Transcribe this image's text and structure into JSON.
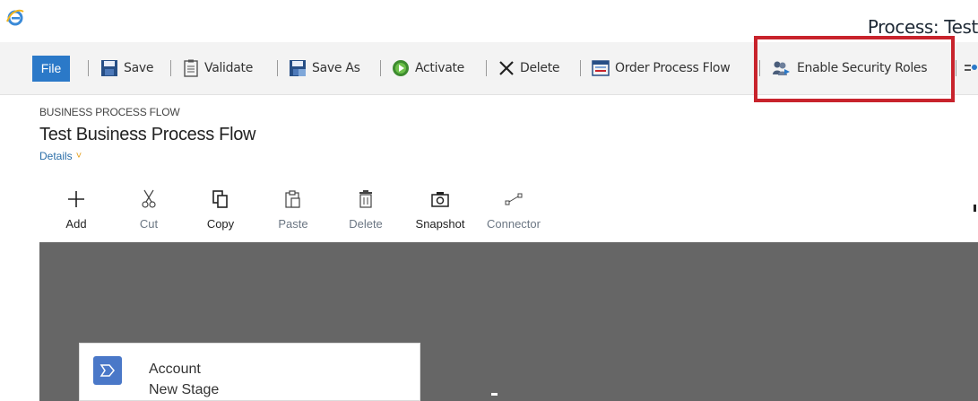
{
  "window": {
    "title": "Process: Test"
  },
  "commandbar": {
    "file": "File",
    "items": [
      {
        "label": "Save",
        "icon": "save-icon"
      },
      {
        "label": "Validate",
        "icon": "validate-icon"
      },
      {
        "label": "Save As",
        "icon": "save-as-icon"
      },
      {
        "label": "Activate",
        "icon": "activate-icon"
      },
      {
        "label": "Delete",
        "icon": "delete-x-icon"
      },
      {
        "label": "Order Process Flow",
        "icon": "order-process-flow-icon"
      },
      {
        "label": "Enable Security Roles",
        "icon": "enable-security-roles-icon"
      }
    ]
  },
  "header": {
    "entity_label": "BUSINESS PROCESS FLOW",
    "title": "Test Business Process Flow",
    "details": "Details"
  },
  "designer_toolbar": [
    {
      "label": "Add",
      "icon": "plus-icon",
      "enabled": true
    },
    {
      "label": "Cut",
      "icon": "scissors-icon",
      "enabled": false
    },
    {
      "label": "Copy",
      "icon": "copy-icon",
      "enabled": true
    },
    {
      "label": "Paste",
      "icon": "paste-icon",
      "enabled": false
    },
    {
      "label": "Delete",
      "icon": "trash-icon",
      "enabled": false
    },
    {
      "label": "Snapshot",
      "icon": "camera-icon",
      "enabled": true
    },
    {
      "label": "Connector",
      "icon": "connector-icon",
      "enabled": false
    }
  ],
  "stage": {
    "entity": "Account",
    "name": "New Stage"
  },
  "colors": {
    "accent": "#2b79c8",
    "highlight": "#c8232c",
    "canvas": "#666666",
    "stage_icon": "#4a78c8"
  }
}
